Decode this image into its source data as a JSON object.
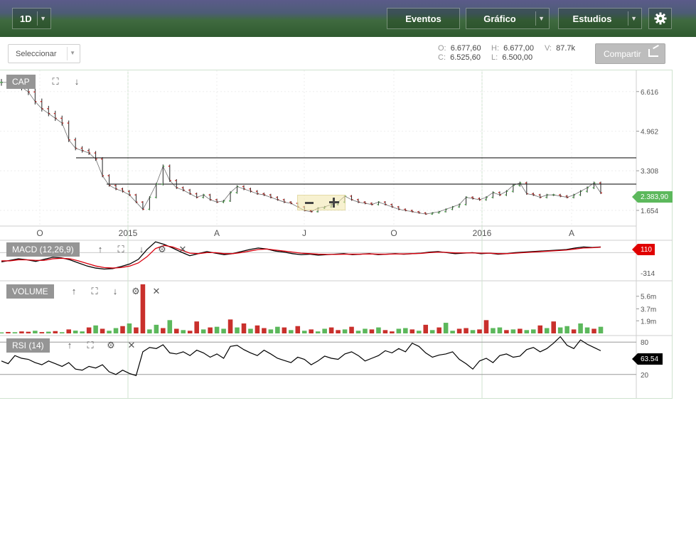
{
  "toolbar": {
    "interval": "1D",
    "events": "Eventos",
    "chart": "Gráfico",
    "studies": "Estudios",
    "settings_icon": "gear-icon"
  },
  "secondary": {
    "select_label": "Seleccionar",
    "share_label": "Compartir",
    "ohlc": {
      "o_key": "O:",
      "o_val": "6.677,60",
      "h_key": "H:",
      "h_val": "6.677,00",
      "v_key": "V:",
      "v_val": "87.7k",
      "c_key": "C:",
      "c_val": "6.525,60",
      "l_key": "L:",
      "l_val": "6.500,00"
    }
  },
  "colors": {
    "up": "#5cb85c",
    "down": "#c9302c",
    "last_price": "#5cb85c",
    "macd_tag": "#e00000",
    "rsi_tag": "#000000"
  },
  "chart_data": [
    {
      "type": "line",
      "pane": "price",
      "title": "CAP",
      "x_tick_labels": [
        "O",
        "2015",
        "A",
        "J",
        "O",
        "2016",
        "A"
      ],
      "y_tick_labels": [
        "6.616",
        "4.962",
        "3.308",
        "1.654"
      ],
      "y_ticks": [
        6616,
        4962,
        3308,
        1654
      ],
      "ylim": [
        1000,
        7500
      ],
      "last_price_label": "2.383,90",
      "last_price": 2383.9,
      "horizontal_lines": [
        3850,
        2750
      ],
      "x": [
        0,
        1,
        2,
        3,
        4,
        5,
        6,
        7,
        8,
        9,
        10,
        11,
        12,
        13,
        14,
        15,
        16,
        17,
        18,
        19,
        20,
        21,
        22,
        23,
        24,
        25,
        26,
        27,
        28,
        29,
        30,
        31,
        32,
        33,
        34,
        35,
        36,
        37,
        38,
        39,
        40,
        41,
        42,
        43,
        44,
        45,
        46,
        47,
        48,
        49,
        50,
        51,
        52,
        53,
        54,
        55,
        56,
        57,
        58,
        59,
        60,
        61,
        62,
        63,
        64,
        65,
        66,
        67,
        68,
        69,
        70,
        71,
        72,
        73,
        74,
        75,
        76,
        77,
        78,
        79,
        80,
        81,
        82,
        83,
        84,
        85,
        86,
        87,
        88,
        89
      ],
      "values": [
        7000,
        7000,
        6900,
        6800,
        6600,
        6200,
        5900,
        5700,
        5500,
        5300,
        4600,
        4250,
        4150,
        4050,
        3800,
        3100,
        2700,
        2550,
        2450,
        2300,
        2000,
        1700,
        2200,
        2750,
        3500,
        2900,
        2600,
        2500,
        2350,
        2200,
        2300,
        2100,
        2000,
        2050,
        2400,
        2650,
        2550,
        2450,
        2350,
        2300,
        2200,
        2100,
        2000,
        1950,
        1800,
        1650,
        1600,
        1750,
        1800,
        1900,
        2000,
        2250,
        2100,
        2000,
        1950,
        1900,
        2000,
        1900,
        1800,
        1700,
        1650,
        1600,
        1550,
        1500,
        1550,
        1600,
        1700,
        1800,
        1900,
        2200,
        2150,
        2100,
        2200,
        2400,
        2300,
        2450,
        2700,
        2800,
        2350,
        2300,
        2200,
        2300,
        2300,
        2250,
        2200,
        2300,
        2450,
        2600,
        2800,
        2384
      ]
    },
    {
      "type": "line",
      "pane": "macd",
      "title": "MACD (12,26,9)",
      "y_tick_labels": [
        "-314"
      ],
      "last_value_label": "110",
      "ylim": [
        -520,
        240
      ],
      "series": [
        {
          "values": [
            -180,
            -150,
            -120,
            -140,
            -170,
            -130,
            -90,
            -100,
            -140,
            -200,
            -260,
            -300,
            -320,
            -310,
            -270,
            -220,
            -130,
            60,
            210,
            160,
            90,
            10,
            -60,
            -20,
            20,
            -10,
            -40,
            -20,
            20,
            60,
            90,
            70,
            30,
            10,
            -20,
            -40,
            -30,
            -50,
            -40,
            -30,
            -20,
            -40,
            -30,
            -20,
            -40,
            -30,
            -20,
            -30,
            -20,
            -10,
            10,
            20,
            0,
            -20,
            -10,
            0,
            -20,
            -10,
            -30,
            -20,
            0,
            10,
            20,
            30,
            40,
            50,
            60,
            90,
            110,
            100,
            110
          ]
        },
        {
          "values": [
            -160,
            -160,
            -140,
            -140,
            -150,
            -150,
            -120,
            -110,
            -120,
            -160,
            -210,
            -260,
            -290,
            -300,
            -290,
            -260,
            -200,
            -80,
            80,
            140,
            110,
            50,
            -10,
            -20,
            0,
            0,
            -20,
            -20,
            0,
            30,
            60,
            70,
            50,
            30,
            10,
            -10,
            -20,
            -30,
            -35,
            -35,
            -30,
            -30,
            -30,
            -25,
            -30,
            -30,
            -25,
            -25,
            -20,
            -15,
            0,
            10,
            5,
            -5,
            -5,
            -5,
            -10,
            -10,
            -20,
            -20,
            -10,
            0,
            10,
            20,
            30,
            40,
            50,
            70,
            90,
            95,
            105
          ]
        }
      ]
    },
    {
      "type": "bar",
      "pane": "volume",
      "title": "VOLUME",
      "y_tick_labels": [
        "5.6m",
        "3.7m",
        "1.9m"
      ],
      "ylim": [
        0,
        7500000
      ],
      "values": [
        150000,
        220000,
        180000,
        300000,
        250000,
        400000,
        200000,
        260000,
        350000,
        180000,
        600000,
        420000,
        300000,
        900000,
        1200000,
        700000,
        400000,
        800000,
        1100000,
        1500000,
        900000,
        7400000,
        600000,
        1300000,
        800000,
        2000000,
        700000,
        500000,
        400000,
        1800000,
        600000,
        900000,
        1000000,
        700000,
        2100000,
        900000,
        1500000,
        700000,
        1200000,
        800000,
        600000,
        1000000,
        900000,
        500000,
        1100000,
        400000,
        600000,
        300000,
        700000,
        900000,
        500000,
        600000,
        1000000,
        400000,
        700000,
        600000,
        900000,
        500000,
        300000,
        700000,
        800000,
        600000,
        400000,
        1300000,
        500000,
        900000,
        1600000,
        400000,
        700000,
        800000,
        500000,
        600000,
        2000000,
        800000,
        900000,
        500000,
        600000,
        700000,
        500000,
        600000,
        1200000,
        800000,
        1800000,
        900000,
        1100000,
        600000,
        1500000,
        900000,
        700000,
        1000000
      ],
      "directions": [
        1,
        0,
        1,
        0,
        0,
        1,
        0,
        1,
        0,
        1,
        0,
        1,
        1,
        0,
        1,
        0,
        1,
        1,
        0,
        1,
        0,
        0,
        1,
        1,
        0,
        1,
        0,
        1,
        0,
        0,
        1,
        0,
        1,
        1,
        0,
        1,
        0,
        1,
        0,
        0,
        1,
        1,
        0,
        1,
        0,
        1,
        0,
        1,
        1,
        0,
        0,
        1,
        0,
        1,
        1,
        0,
        1,
        0,
        0,
        1,
        1,
        0,
        1,
        0,
        1,
        0,
        1,
        1,
        0,
        0,
        1,
        0,
        0,
        1,
        1,
        0,
        1,
        0,
        1,
        1,
        0,
        1,
        0,
        1,
        1,
        0,
        1,
        1,
        0,
        1
      ]
    },
    {
      "type": "line",
      "pane": "rsi",
      "title": "RSI (14)",
      "y_tick_labels": [
        "80",
        "20"
      ],
      "y_ticks": [
        80,
        20
      ],
      "ylim": [
        0,
        100
      ],
      "last_value_label": "63.54",
      "values": [
        45,
        40,
        55,
        50,
        48,
        42,
        38,
        45,
        40,
        35,
        42,
        30,
        28,
        35,
        32,
        38,
        25,
        20,
        28,
        22,
        18,
        62,
        70,
        68,
        75,
        60,
        58,
        62,
        55,
        65,
        60,
        52,
        58,
        50,
        72,
        74,
        66,
        60,
        55,
        65,
        58,
        50,
        46,
        42,
        52,
        48,
        38,
        45,
        54,
        50,
        48,
        58,
        62,
        55,
        45,
        50,
        55,
        64,
        60,
        68,
        62,
        78,
        72,
        60,
        52,
        56,
        58,
        62,
        48,
        40,
        30,
        45,
        50,
        42,
        55,
        58,
        52,
        54,
        66,
        70,
        62,
        68,
        78,
        90,
        74,
        68,
        84,
        76,
        70,
        64
      ]
    }
  ]
}
